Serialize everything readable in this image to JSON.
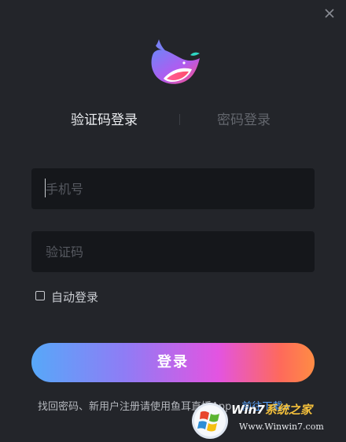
{
  "window": {
    "close_icon": "close-icon"
  },
  "logo": {
    "icon": "whale-logo-icon",
    "colors": [
      "#6f84f7",
      "#e54be7",
      "#ff4f7f",
      "#ffffff"
    ]
  },
  "tabs": {
    "sms_login": "验证码登录",
    "password_login": "密码登录",
    "active": "sms_login"
  },
  "form": {
    "phone_placeholder": "手机号",
    "phone_value": "",
    "code_placeholder": "验证码",
    "code_value": "",
    "auto_login_label": "自动登录",
    "auto_login_checked": false,
    "login_button": "登录"
  },
  "footer": {
    "text": "找回密码、新用户注册请使用鱼耳直播App，",
    "link": "前往下载",
    "link_icon": "double-chevron-right-icon"
  },
  "watermark": {
    "logo_icon": "windows-logo-icon",
    "title_part1": "Win7",
    "title_part2": "系统之家",
    "url": "Www.Winwin7.com"
  },
  "colors": {
    "background": "#23252a",
    "input_bg": "#15171b",
    "link": "#59a4ff",
    "button_gradient": [
      "#57a8f9",
      "#8f7cf5",
      "#e354e1",
      "#fe6a5b",
      "#fe8c44"
    ]
  }
}
